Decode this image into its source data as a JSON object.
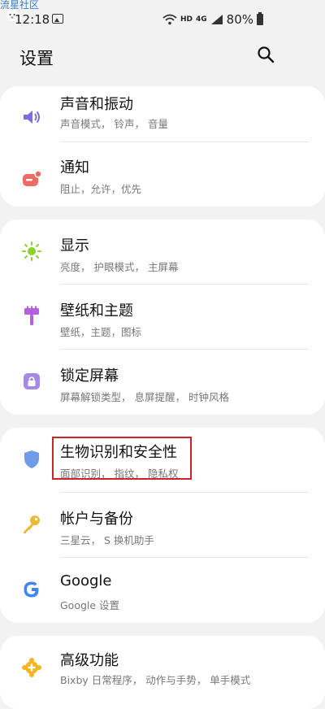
{
  "watermark": "流星社区",
  "status": {
    "time": "12:18",
    "hd": "HD",
    "network": "4G",
    "battery": "80%"
  },
  "header": {
    "title": "设置"
  },
  "items": [
    {
      "title": "声音和振动",
      "sub": "声音模式， 铃声， 音量",
      "icon": "volume-icon",
      "color": "#7a6ee0"
    },
    {
      "title": "通知",
      "sub": "阻止，允许，优先",
      "icon": "notification-icon",
      "color": "#ee6b64"
    },
    {
      "title": "显示",
      "sub": "亮度， 护眼模式， 主屏幕",
      "icon": "sun-icon",
      "color": "#8bd32a"
    },
    {
      "title": "壁纸和主题",
      "sub": "壁纸，主题，图标",
      "icon": "paint-brush-icon",
      "color": "#b45ee0"
    },
    {
      "title": "锁定屏幕",
      "sub": "屏幕解锁类型， 息屏提醒， 时钟风格",
      "icon": "lock-icon",
      "color": "#a48ae6"
    },
    {
      "title": "生物识别和安全性",
      "sub": "面部识别， 指纹， 隐私权",
      "icon": "shield-icon",
      "color": "#6f9be8"
    },
    {
      "title": "帐户与备份",
      "sub": "三星云， S 换机助手",
      "icon": "key-icon",
      "color": "#f0b93a"
    },
    {
      "title": "Google",
      "sub": "Google 设置",
      "icon": "google-icon",
      "color": "#4285f4"
    },
    {
      "title": "高级功能",
      "sub": "Bixby 日常程序， 动作与手势， 单手模式",
      "icon": "gear-plus-icon",
      "color": "#f3b623"
    }
  ]
}
